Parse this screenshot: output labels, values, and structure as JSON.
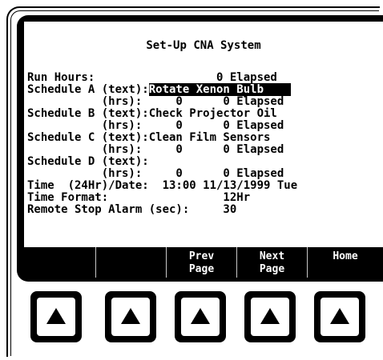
{
  "screen": {
    "title": "Set-Up CNA System",
    "lines": [
      {
        "text": "Run Hours:                  0 Elapsed"
      },
      {
        "pre": "Schedule A (text):",
        "hl": "Rotate Xenon Bulb    "
      },
      {
        "text": "           (hrs):     0      0 Elapsed"
      },
      {
        "text": "Schedule B (text):Check Projector Oil"
      },
      {
        "text": "           (hrs):     0      0 Elapsed"
      },
      {
        "text": "Schedule C (text):Clean Film Sensors"
      },
      {
        "text": "           (hrs):     0      0 Elapsed"
      },
      {
        "text": "Schedule D (text):"
      },
      {
        "text": "           (hrs):     0      0 Elapsed"
      },
      {
        "text": "Time  (24Hr)/Date:  13:00 11/13/1999 Tue"
      },
      {
        "text": "Time Format:                 12Hr"
      },
      {
        "text": "Remote Stop Alarm (sec):     30"
      }
    ]
  },
  "softkeys": [
    {
      "line1": "",
      "line2": ""
    },
    {
      "line1": "",
      "line2": ""
    },
    {
      "line1": "Prev",
      "line2": "Page"
    },
    {
      "line1": "Next",
      "line2": "Page"
    },
    {
      "line1": "Home",
      "line2": ""
    }
  ],
  "buttons": [
    {
      "icon": "up-triangle-icon"
    },
    {
      "icon": "up-triangle-icon"
    },
    {
      "icon": "up-triangle-icon"
    },
    {
      "icon": "up-triangle-icon"
    },
    {
      "icon": "up-triangle-icon"
    }
  ]
}
